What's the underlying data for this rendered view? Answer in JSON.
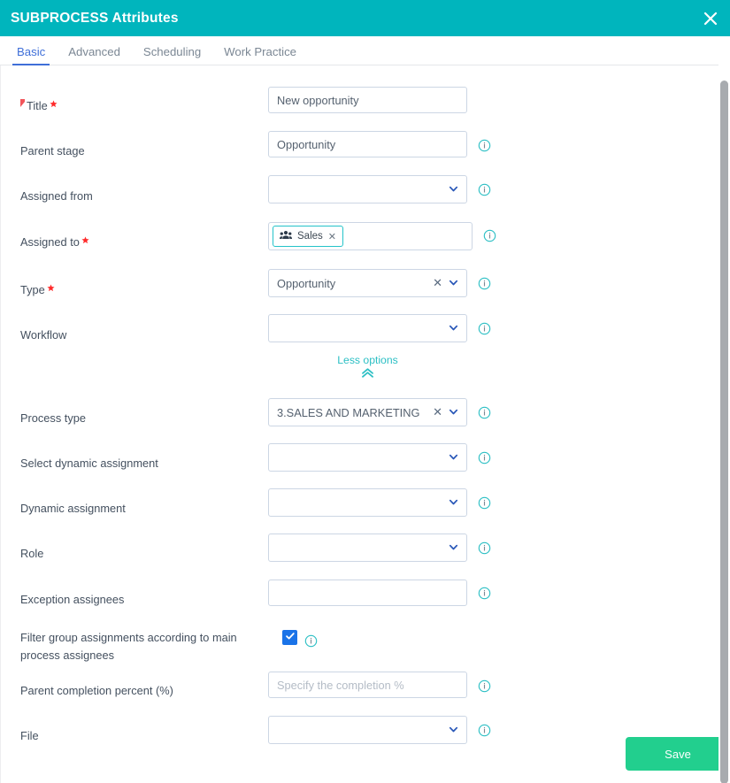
{
  "window": {
    "title": "SUBPROCESS Attributes",
    "close_icon": "close-icon"
  },
  "tabs": [
    {
      "label": "Basic",
      "active": true
    },
    {
      "label": "Advanced",
      "active": false
    },
    {
      "label": "Scheduling",
      "active": false
    },
    {
      "label": "Work Practice",
      "active": false
    }
  ],
  "form": {
    "fields": [
      {
        "label": "Title",
        "required": true,
        "flag": true,
        "value": "New opportunity",
        "placeholder": "",
        "type": "text",
        "info": false,
        "clearable": false
      },
      {
        "label": "Parent stage",
        "required": false,
        "flag": false,
        "value": "Opportunity",
        "placeholder": "",
        "type": "text",
        "info": true,
        "clearable": false
      },
      {
        "label": "Assigned from",
        "required": false,
        "flag": false,
        "value": "",
        "placeholder": "",
        "type": "select",
        "info": true,
        "clearable": false
      },
      {
        "label": "Assigned to",
        "required": true,
        "flag": false,
        "value": "",
        "placeholder": "",
        "type": "tags",
        "info": true,
        "clearable": false,
        "tags": [
          {
            "text": "Sales",
            "icon": "group-icon"
          }
        ]
      },
      {
        "label": "Type",
        "required": true,
        "flag": false,
        "value": "Opportunity",
        "placeholder": "",
        "type": "select",
        "info": true,
        "clearable": true
      },
      {
        "label": "Workflow",
        "required": false,
        "flag": false,
        "value": "",
        "placeholder": "",
        "type": "select",
        "info": true,
        "clearable": false
      }
    ],
    "toggle": {
      "label": "Less options",
      "icon": "double-chevron-up-icon"
    },
    "fields2": [
      {
        "label": "Process type",
        "required": false,
        "flag": false,
        "value": "3.SALES AND MARKETING",
        "placeholder": "",
        "type": "select",
        "info": true,
        "clearable": true
      },
      {
        "label": "Select dynamic assignment",
        "required": false,
        "flag": false,
        "value": "",
        "placeholder": "",
        "type": "select",
        "info": true,
        "clearable": false
      },
      {
        "label": "Dynamic assignment",
        "required": false,
        "flag": false,
        "value": "",
        "placeholder": "",
        "type": "select",
        "info": true,
        "clearable": false
      },
      {
        "label": "Role",
        "required": false,
        "flag": false,
        "value": "",
        "placeholder": "",
        "type": "select",
        "info": true,
        "clearable": false
      },
      {
        "label": "Exception assignees",
        "required": false,
        "flag": false,
        "value": "",
        "placeholder": "",
        "type": "text",
        "info": true,
        "clearable": false
      }
    ],
    "checkbox_row": {
      "label": "Filter group assignments according to main process assignees",
      "checked": true,
      "info": true
    },
    "fields3": [
      {
        "label": "Parent completion percent (%)",
        "required": false,
        "flag": false,
        "value": "",
        "placeholder": "Specify the completion %",
        "type": "text",
        "info": true,
        "clearable": false
      },
      {
        "label": "File",
        "required": false,
        "flag": false,
        "value": "",
        "placeholder": "",
        "type": "select",
        "info": true,
        "clearable": false
      }
    ]
  },
  "footer": {
    "save_label": "Save"
  },
  "colors": {
    "header_teal": "#00b5bd",
    "tab_active_blue": "#3f6fd8",
    "save_green": "#22cf8e",
    "required_red": "#ff2a2a",
    "link_teal": "#2bbfc4",
    "checkbox_blue": "#1a73e8"
  }
}
